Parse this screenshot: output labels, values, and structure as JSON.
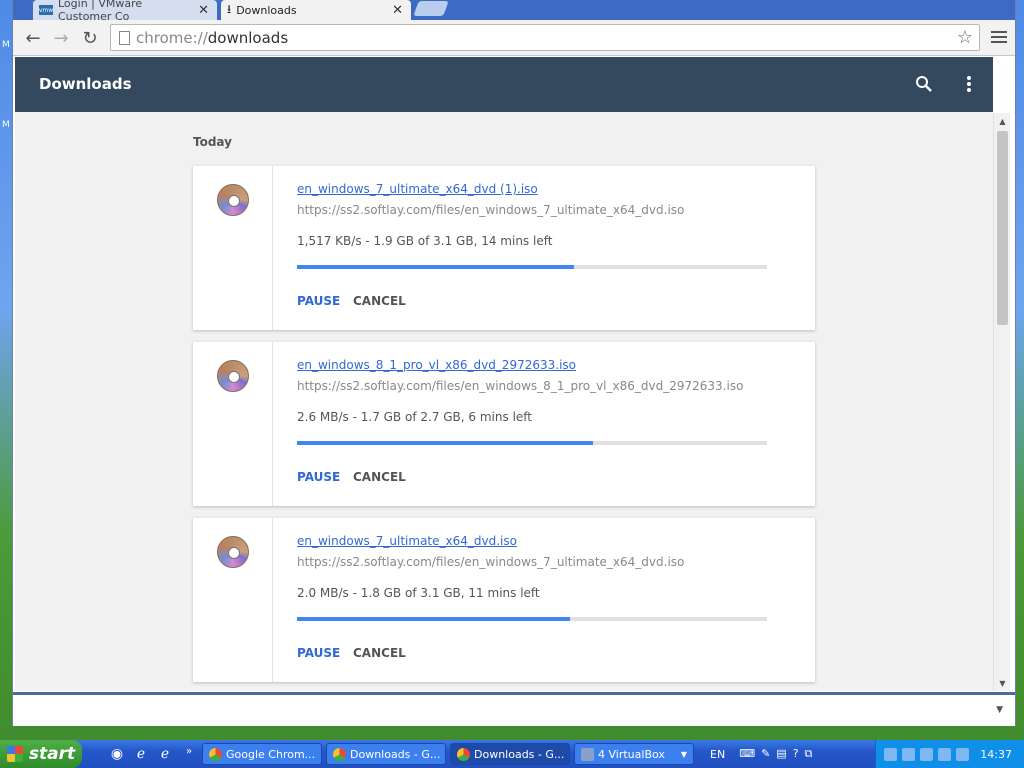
{
  "browser": {
    "tabs": [
      {
        "label": "Login | VMware Customer Co",
        "favicon": "vmware-icon",
        "active": false
      },
      {
        "label": "Downloads",
        "favicon": "download-icon",
        "active": true
      }
    ],
    "url_scheme": "chrome://",
    "url_path": "downloads"
  },
  "page": {
    "title": "Downloads",
    "section": "Today",
    "pause_label": "PAUSE",
    "cancel_label": "CANCEL",
    "downloads": [
      {
        "filename": "en_windows_7_ultimate_x64_dvd (1).iso",
        "url": "https://ss2.softlay.com/files/en_windows_7_ultimate_x64_dvd.iso",
        "status": "1,517 KB/s - 1.9 GB of 3.1 GB, 14 mins left",
        "progress": 0.59
      },
      {
        "filename": "en_windows_8_1_pro_vl_x86_dvd_2972633.iso",
        "url": "https://ss2.softlay.com/files/en_windows_8_1_pro_vl_x86_dvd_2972633.iso",
        "status": "2.6 MB/s - 1.7 GB of 2.7 GB, 6 mins left",
        "progress": 0.63
      },
      {
        "filename": "en_windows_7_ultimate_x64_dvd.iso",
        "url": "https://ss2.softlay.com/files/en_windows_7_ultimate_x64_dvd.iso",
        "status": "2.0 MB/s - 1.8 GB of 3.1 GB, 11 mins left",
        "progress": 0.58
      }
    ]
  },
  "taskbar": {
    "start_label": "start",
    "buttons": [
      {
        "label": "Google Chrom...",
        "icon": "ie-icon",
        "active": false
      },
      {
        "label": "Downloads - G...",
        "icon": "chrome-icon",
        "active": false
      },
      {
        "label": "Downloads - G...",
        "icon": "chrome-icon",
        "active": true
      },
      {
        "label": "4 VirtualBox",
        "icon": "virtualbox-icon",
        "active": false
      }
    ],
    "language": "EN",
    "clock": "14:37"
  },
  "colors": {
    "appbar": "#34495e",
    "link": "#3367d6",
    "progress": "#4285f4"
  }
}
